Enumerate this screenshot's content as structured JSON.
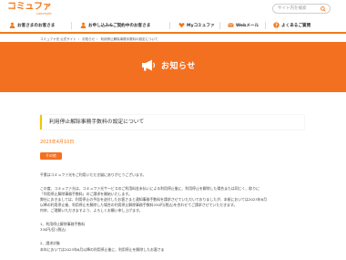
{
  "header": {
    "logo_main": "コミュファ",
    "logo_sub": "commufa",
    "search_placeholder": "サイト内を検索"
  },
  "gnav": {
    "items": [
      {
        "label": "お客さまのお客さま",
        "icon": "person-icon"
      },
      {
        "label": "お申し込み&ご契約中のお客さま",
        "icon": "person-icon"
      },
      {
        "label": "Myコミュファ",
        "icon": "heart-icon"
      },
      {
        "label": "Webメール",
        "icon": "mail-icon"
      },
      {
        "label": "よくあるご質問",
        "icon": "question-icon"
      }
    ]
  },
  "breadcrumb": [
    "コミュファ光 公式サイト",
    "お知らせ",
    "利用停止解除事務手数料の設定について"
  ],
  "hero": {
    "title": "お知らせ"
  },
  "article": {
    "title": "利用停止解除事務手数料の設定について",
    "date": "2023年4月10日",
    "badge": "その他",
    "paragraphs": [
      "平素はコミュファ光をご利用いただき誠にありがとうございます。",
      "この度、コミュファ光は、コミュファ光サービスのご利用料金未払いによる利用停止後に、利用停止を解除した場合または同じく、取りに",
      "「利用停止解除事務手数料」のご請求を開始いたします。",
      "弊社におきましては、利用停止の予告を送付したお客さまと通知事務手数料を請求させていただいておりましたが、本紙においては2023年6月",
      "以降の利用停止後、利用停止を解除した場合の利用停止解除事務手数料330円(税込)を合わせてご請求させていただきます。",
      "何卒、ご理解いただきますよう、よろしくお願い申し上げます。",
      "1、利用停止解除事務手数料",
      "330円/回 (税込)",
      "2、請求対象",
      "本年においては2023年6月以降の利用停止後に、利用停止を解除したお客さま"
    ]
  },
  "colors": {
    "brand": "#f37021",
    "accent": "#f6c400"
  }
}
